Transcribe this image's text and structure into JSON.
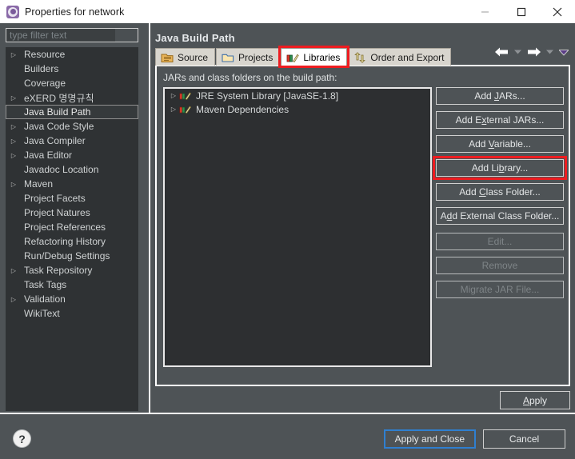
{
  "window": {
    "title": "Properties for network",
    "icon": "properties-gear-icon",
    "controls": {
      "minimize": "minimize-icon",
      "maximize": "maximize-icon",
      "close": "close-icon"
    }
  },
  "sidebar": {
    "filter": {
      "placeholder": "type filter text",
      "value": ""
    },
    "items": [
      {
        "label": "Resource",
        "expandable": true,
        "selected": false
      },
      {
        "label": "Builders",
        "expandable": false,
        "selected": false
      },
      {
        "label": "Coverage",
        "expandable": false,
        "selected": false
      },
      {
        "label": "eXERD 명명규칙",
        "expandable": true,
        "selected": false
      },
      {
        "label": "Java Build Path",
        "expandable": false,
        "selected": true
      },
      {
        "label": "Java Code Style",
        "expandable": true,
        "selected": false
      },
      {
        "label": "Java Compiler",
        "expandable": true,
        "selected": false
      },
      {
        "label": "Java Editor",
        "expandable": true,
        "selected": false
      },
      {
        "label": "Javadoc Location",
        "expandable": false,
        "selected": false
      },
      {
        "label": "Maven",
        "expandable": true,
        "selected": false
      },
      {
        "label": "Project Facets",
        "expandable": false,
        "selected": false
      },
      {
        "label": "Project Natures",
        "expandable": false,
        "selected": false
      },
      {
        "label": "Project References",
        "expandable": false,
        "selected": false
      },
      {
        "label": "Refactoring History",
        "expandable": false,
        "selected": false
      },
      {
        "label": "Run/Debug Settings",
        "expandable": false,
        "selected": false
      },
      {
        "label": "Task Repository",
        "expandable": true,
        "selected": false
      },
      {
        "label": "Task Tags",
        "expandable": false,
        "selected": false
      },
      {
        "label": "Validation",
        "expandable": true,
        "selected": false
      },
      {
        "label": "WikiText",
        "expandable": false,
        "selected": false
      }
    ]
  },
  "page": {
    "title": "Java Build Path",
    "nav": {
      "back": "back-arrow-icon",
      "back_menu": "chevron-down-icon",
      "forward": "forward-arrow-icon",
      "forward_menu": "chevron-down-icon",
      "view_menu": "view-menu-chevron-icon"
    },
    "tabs": [
      {
        "label": "Source",
        "icon": "source-folder-icon",
        "active": false,
        "highlighted": false
      },
      {
        "label": "Projects",
        "icon": "projects-folder-icon",
        "active": false,
        "highlighted": false
      },
      {
        "label": "Libraries",
        "icon": "libraries-books-icon",
        "active": true,
        "highlighted": true
      },
      {
        "label": "Order and Export",
        "icon": "order-export-icon",
        "active": false,
        "highlighted": false
      }
    ],
    "list_label": "JARs and class folders on the build path:",
    "entries": [
      {
        "label": "JRE System Library [JavaSE-1.8]",
        "icon": "library-icon",
        "expandable": true
      },
      {
        "label": "Maven Dependencies",
        "icon": "library-icon",
        "expandable": true
      }
    ],
    "buttons": [
      {
        "label": "Add JARs...",
        "mnemonic": "J",
        "disabled": false,
        "highlighted": false
      },
      {
        "label": "Add External JARs...",
        "mnemonic": "x",
        "disabled": false,
        "highlighted": false
      },
      {
        "label": "Add Variable...",
        "mnemonic": "V",
        "disabled": false,
        "highlighted": false
      },
      {
        "label": "Add Library...",
        "mnemonic": "b",
        "disabled": false,
        "highlighted": true
      },
      {
        "label": "Add Class Folder...",
        "mnemonic": "C",
        "disabled": false,
        "highlighted": false
      },
      {
        "label": "Add External Class Folder...",
        "mnemonic": "d",
        "disabled": false,
        "highlighted": false
      },
      {
        "label": "Edit...",
        "mnemonic": "",
        "disabled": true,
        "highlighted": false
      },
      {
        "label": "Remove",
        "mnemonic": "",
        "disabled": true,
        "highlighted": false
      },
      {
        "label": "Migrate JAR File...",
        "mnemonic": "",
        "disabled": true,
        "highlighted": false
      }
    ],
    "apply_label": "Apply",
    "apply_mnemonic": "A"
  },
  "footer": {
    "help": "?",
    "apply_and_close": "Apply and Close",
    "cancel": "Cancel"
  },
  "colors": {
    "highlight_red": "#ee1c20",
    "focus_blue": "#2f7fd0",
    "window_bg": "#4e5356",
    "tree_bg": "#2f3234",
    "tab_active_bg": "#ffffff"
  }
}
